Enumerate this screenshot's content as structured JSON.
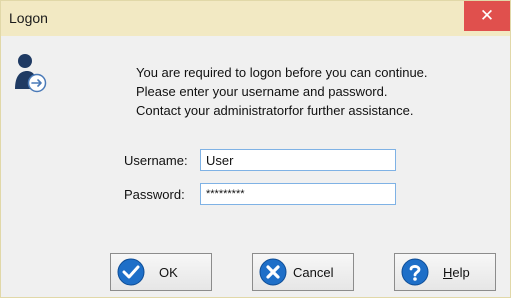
{
  "window": {
    "title": "Logon",
    "close_glyph": "✕"
  },
  "icons": {
    "user": "user-arrow-icon",
    "ok": "checkmark-icon",
    "cancel": "x-icon",
    "help": "question-icon"
  },
  "message": [
    "You are required to logon before you can continue.",
    "Please enter your username and password.",
    "Contact your administratorfor further assistance."
  ],
  "form": {
    "username_label": "Username:",
    "username_value": "User",
    "password_label": "Password:",
    "password_value": "*********"
  },
  "buttons": {
    "ok_label": "OK",
    "cancel_label": "Cancel",
    "help_label_first": "H",
    "help_label_rest": "elp"
  },
  "colors": {
    "titlebar": "#f2e9c3",
    "close": "#e0504d",
    "icon_blue": "#1e6fc8",
    "input_border": "#7fb2e5"
  }
}
